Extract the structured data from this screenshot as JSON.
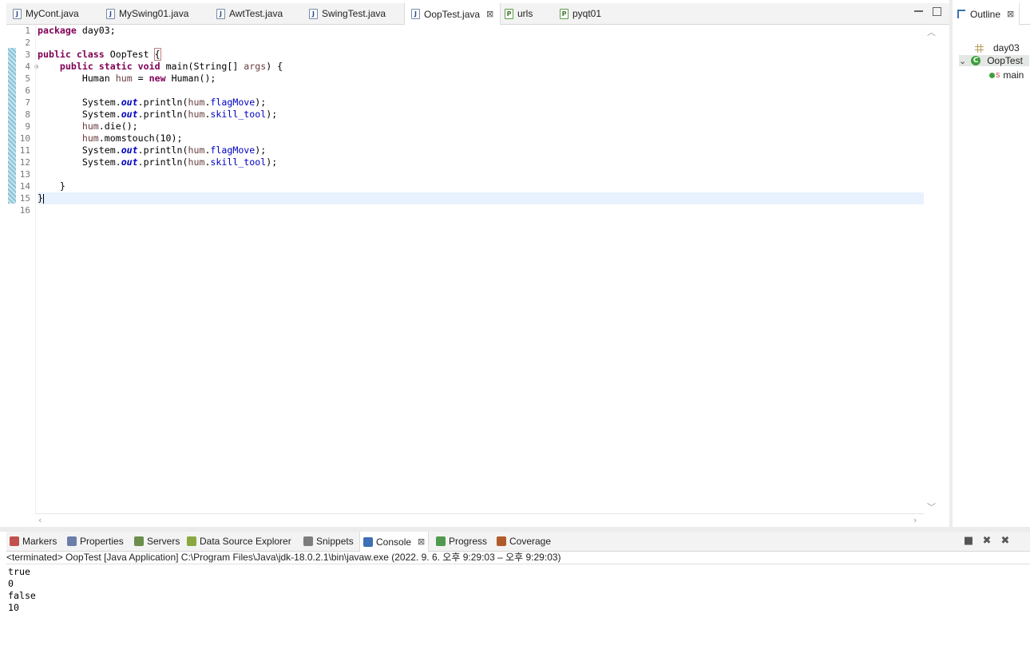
{
  "editor_tabs": [
    {
      "label": "MyCont.java",
      "icon": "java-file-icon"
    },
    {
      "label": "MySwing01.java",
      "icon": "java-file-icon"
    },
    {
      "label": "AwtTest.java",
      "icon": "java-file-icon"
    },
    {
      "label": "SwingTest.java",
      "icon": "java-file-icon"
    },
    {
      "label": "OopTest.java",
      "icon": "java-file-icon",
      "active": true,
      "close_glyph": "⊠"
    },
    {
      "label": "urls",
      "icon": "python-file-icon"
    },
    {
      "label": "pyqt01",
      "icon": "python-file-icon"
    }
  ],
  "editor": {
    "line_numbers": [
      "1",
      "2",
      "3",
      "4",
      "5",
      "6",
      "7",
      "8",
      "9",
      "10",
      "11",
      "12",
      "13",
      "14",
      "15",
      "16"
    ],
    "fold_marker": "⊖",
    "lines": [
      {
        "plain": "package day03;"
      },
      {
        "plain": ""
      },
      {
        "plain": "public class OopTest {"
      },
      {
        "plain": "    public static void main(String[] args) {"
      },
      {
        "plain": "        Human hum = new Human();"
      },
      {
        "plain": ""
      },
      {
        "plain": "        System.out.println(hum.flagMove);"
      },
      {
        "plain": "        System.out.println(hum.skill_tool);"
      },
      {
        "plain": "        hum.die();"
      },
      {
        "plain": "        hum.momstouch(10);"
      },
      {
        "plain": "        System.out.println(hum.flagMove);"
      },
      {
        "plain": "        System.out.println(hum.skill_tool);"
      },
      {
        "plain": ""
      },
      {
        "plain": "    }"
      },
      {
        "plain": "}",
        "current": true
      },
      {
        "plain": ""
      }
    ]
  },
  "outline": {
    "title": "Outline",
    "close_glyph": "⊠",
    "items": [
      {
        "label": "day03",
        "icon": "package-icon"
      },
      {
        "label": "OopTest",
        "icon": "class-icon",
        "expanded": true
      },
      {
        "label": "main",
        "icon": "method-icon",
        "modifier": "S"
      }
    ]
  },
  "console_tabs": [
    {
      "label": "Markers",
      "icon": "markers-icon",
      "color": "#c0504d"
    },
    {
      "label": "Properties",
      "icon": "properties-icon",
      "color": "#6a7ea8"
    },
    {
      "label": "Servers",
      "icon": "servers-icon",
      "color": "#6b8e4e"
    },
    {
      "label": "Data Source Explorer",
      "icon": "data-source-icon",
      "color": "#8aa83f"
    },
    {
      "label": "Snippets",
      "icon": "snippets-icon",
      "color": "#7d7d7d"
    },
    {
      "label": "Console",
      "icon": "console-icon",
      "color": "#3c6fb4",
      "active": true,
      "close_glyph": "⊠"
    },
    {
      "label": "Progress",
      "icon": "progress-icon",
      "color": "#4f9a4f"
    },
    {
      "label": "Coverage",
      "icon": "coverage-icon",
      "color": "#b05b2b"
    }
  ],
  "console": {
    "status": "<terminated> OopTest [Java Application] C:\\Program Files\\Java\\jdk-18.0.2.1\\bin\\javaw.exe  (2022. 9. 6. 오후 9:29:03 – 오후 9:29:03)",
    "output": [
      "true",
      "0",
      "false",
      "10"
    ]
  },
  "toolbar_glyphs": {
    "stop": "■",
    "remove": "✖",
    "remove_all": "✖"
  }
}
